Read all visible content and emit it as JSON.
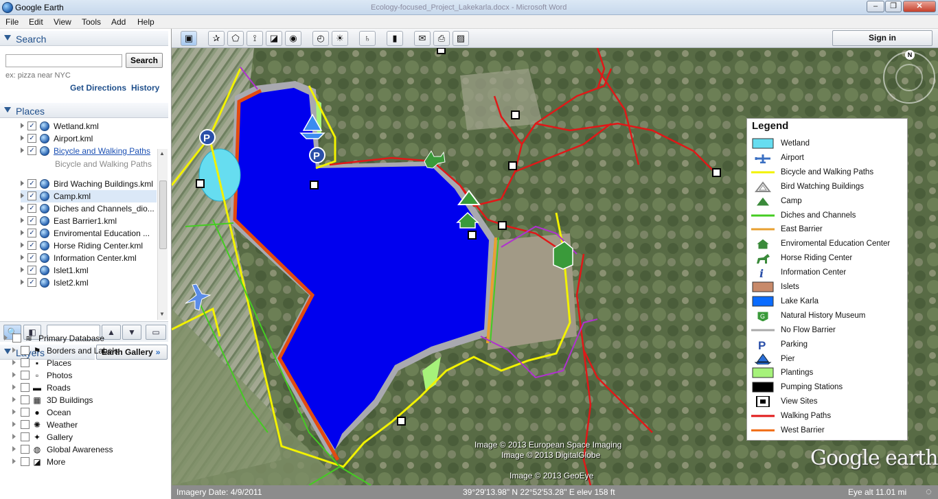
{
  "window": {
    "title": "Google Earth",
    "background_title": "Ecology-focused_Project_Lakekarla.docx - Microsoft Word",
    "controls": {
      "minimize": "–",
      "maximize": "❐",
      "close": "✕"
    }
  },
  "menu": [
    "File",
    "Edit",
    "View",
    "Tools",
    "Add",
    "Help"
  ],
  "search": {
    "title": "Search",
    "placeholder": "",
    "button": "Search",
    "hint": "ex: pizza near NYC",
    "get_directions": "Get Directions",
    "history": "History"
  },
  "places": {
    "title": "Places",
    "items": [
      {
        "label": "Wetland.kml",
        "checked": true,
        "link": false,
        "selected": false
      },
      {
        "label": "Airport.kml",
        "checked": true,
        "link": false,
        "selected": false
      },
      {
        "label": "Bicycle and Walking Paths",
        "checked": true,
        "link": true,
        "selected": false
      },
      {
        "label": "Bird Waching Buildings.kml",
        "checked": true,
        "link": false,
        "selected": false
      },
      {
        "label": "Camp.kml",
        "checked": true,
        "link": false,
        "selected": true
      },
      {
        "label": "Diches and Channels_dio...",
        "checked": true,
        "link": false,
        "selected": false
      },
      {
        "label": "East Barrier1.kml",
        "checked": true,
        "link": false,
        "selected": false
      },
      {
        "label": "Enviromental Education ...",
        "checked": true,
        "link": false,
        "selected": false
      },
      {
        "label": "Horse Riding Center.kml",
        "checked": true,
        "link": false,
        "selected": false
      },
      {
        "label": "Information Center.kml",
        "checked": true,
        "link": false,
        "selected": false
      },
      {
        "label": "Islet1.kml",
        "checked": true,
        "link": false,
        "selected": false
      },
      {
        "label": "Islet2.kml",
        "checked": true,
        "link": false,
        "selected": false
      }
    ],
    "description": "Bicycle and Walking Paths"
  },
  "layers": {
    "title": "Layers",
    "gallery_button": "Earth Gallery",
    "gallery_chevron": "»",
    "items": [
      {
        "label": "Primary Database",
        "icon": "database-icon",
        "glyph": "≋"
      },
      {
        "label": "Borders and Labels",
        "icon": "flag-icon",
        "glyph": "⚑"
      },
      {
        "label": "Places",
        "icon": "places-icon",
        "glyph": "▪"
      },
      {
        "label": "Photos",
        "icon": "photos-icon",
        "glyph": "▫"
      },
      {
        "label": "Roads",
        "icon": "roads-icon",
        "glyph": "▬"
      },
      {
        "label": "3D Buildings",
        "icon": "buildings-icon",
        "glyph": "▦"
      },
      {
        "label": "Ocean",
        "icon": "ocean-icon",
        "glyph": "●"
      },
      {
        "label": "Weather",
        "icon": "weather-icon",
        "glyph": "✺"
      },
      {
        "label": "Gallery",
        "icon": "gallery-icon",
        "glyph": "✦"
      },
      {
        "label": "Global Awareness",
        "icon": "globe-icon",
        "glyph": "◍"
      },
      {
        "label": "More",
        "icon": "more-icon",
        "glyph": "◪"
      }
    ]
  },
  "toolbar": {
    "sign_in": "Sign in"
  },
  "legend": {
    "title": "Legend",
    "items": [
      {
        "label": "Wetland",
        "kind": "box",
        "color": "#66ddf0"
      },
      {
        "label": "Airport",
        "kind": "plane",
        "color": "#3a6fc2"
      },
      {
        "label": "Bicycle and Walking Paths",
        "kind": "line",
        "color": "#f2f200"
      },
      {
        "label": "Bird Watching Buildings",
        "kind": "triangle-outline",
        "color": "#888888"
      },
      {
        "label": "Camp",
        "kind": "triangle",
        "color": "#3a8a3a"
      },
      {
        "label": "Diches and Channels",
        "kind": "line",
        "color": "#44cc22"
      },
      {
        "label": "East Barrier",
        "kind": "line",
        "color": "#e8a030"
      },
      {
        "label": "Enviromental Education Center",
        "kind": "house",
        "color": "#3a8a3a"
      },
      {
        "label": "Horse Riding Center",
        "kind": "horse",
        "color": "#3a8a3a"
      },
      {
        "label": "Information Center",
        "kind": "info",
        "color": "#2a4fa8"
      },
      {
        "label": "Islets",
        "kind": "box",
        "color": "#c88a6a"
      },
      {
        "label": "Lake Karla",
        "kind": "box",
        "color": "#0b6cff"
      },
      {
        "label": "Natural History Museum",
        "kind": "museum",
        "color": "#3a9a3a"
      },
      {
        "label": "No Flow Barrier",
        "kind": "line",
        "color": "#aaaaaa"
      },
      {
        "label": "Parking",
        "kind": "parking",
        "color": "#2a4fa8"
      },
      {
        "label": "Pier",
        "kind": "pier",
        "color": "#2a6fd8"
      },
      {
        "label": "Plantings",
        "kind": "box",
        "color": "#a6f27a"
      },
      {
        "label": "Pumping Stations",
        "kind": "box",
        "color": "#000000"
      },
      {
        "label": "View Sites",
        "kind": "viewsite",
        "color": "#000000"
      },
      {
        "label": "Walking Paths",
        "kind": "line",
        "color": "#e01818"
      },
      {
        "label": "West Barrier",
        "kind": "line",
        "color": "#f06a10"
      }
    ]
  },
  "credits": {
    "line1": "Image © 2013 European Space Imaging",
    "line2": "Image © 2013 DigitalGlobe",
    "line3": "Image © 2013 GeoEye"
  },
  "logo": "Google earth",
  "compass_letter": "N",
  "status": {
    "imagery_date": "Imagery Date: 4/9/2011",
    "coordinates": "39°29'13.98\" N   22°52'53.28\" E  elev   158 ft",
    "eye_alt": "Eye alt      11.01 mi"
  },
  "colors": {
    "lake": "#0000ee",
    "wetland": "#66ddf0",
    "walking_path": "#e01818",
    "bicycle_path": "#f2f200",
    "west_barrier": "#f06a10",
    "channel": "#44cc22",
    "purple_path": "#b030d0"
  }
}
